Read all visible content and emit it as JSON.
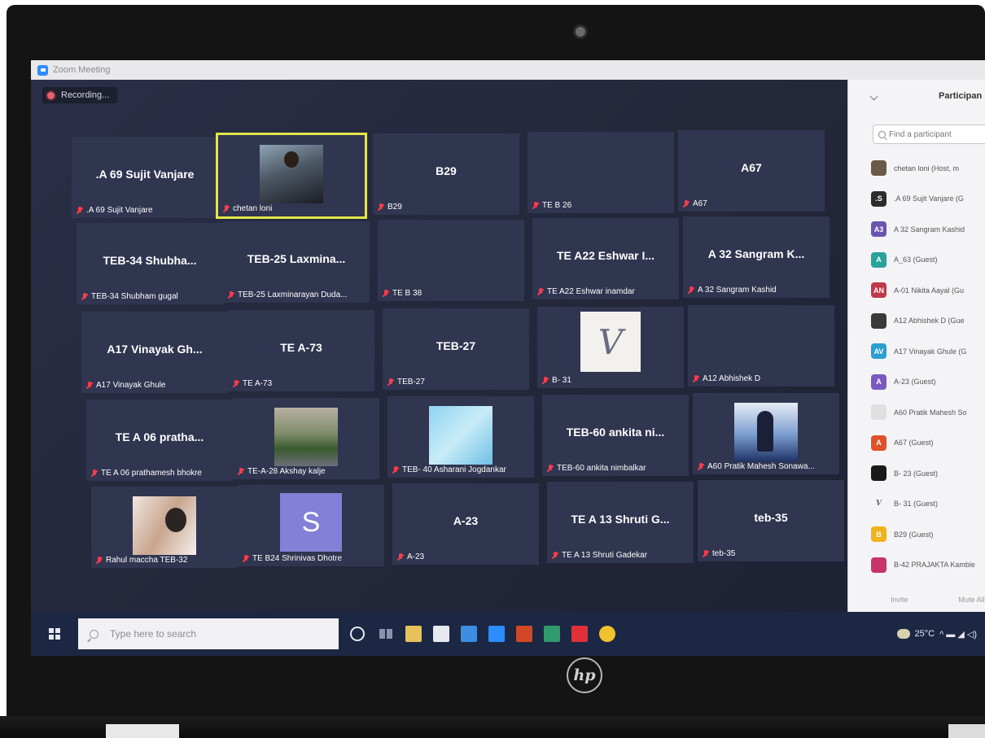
{
  "window": {
    "title": "Zoom Meeting"
  },
  "recording": {
    "label": "Recording..."
  },
  "tiles": [
    {
      "title": ".A 69 Sujit Vanjare",
      "name": ".A 69 Sujit Vanjare",
      "pic": ""
    },
    {
      "title": "",
      "name": "chetan loni",
      "pic": "person",
      "active": true
    },
    {
      "title": "B29",
      "name": "B29",
      "pic": ""
    },
    {
      "title": "",
      "name": "TE B 26",
      "pic": ""
    },
    {
      "title": "A67",
      "name": "A67",
      "pic": ""
    },
    {
      "title": "TEB-34 Shubha...",
      "name": "TEB-34 Shubham gugal",
      "pic": ""
    },
    {
      "title": "TEB-25 Laxmina...",
      "name": "TEB-25 Laxminarayan Duda...",
      "pic": ""
    },
    {
      "title": "",
      "name": "TE B 38",
      "pic": ""
    },
    {
      "title": "TE A22 Eshwar I...",
      "name": "TE A22 Eshwar inamdar",
      "pic": ""
    },
    {
      "title": "A 32 Sangram K...",
      "name": "A 32 Sangram Kashid",
      "pic": ""
    },
    {
      "title": "A17 Vinayak Gh...",
      "name": "A17 Vinayak Ghule",
      "pic": ""
    },
    {
      "title": "TE A-73",
      "name": "TE A-73",
      "pic": ""
    },
    {
      "title": "TEB-27",
      "name": "TEB-27",
      "pic": ""
    },
    {
      "title": "",
      "name": "B- 31",
      "pic": "v",
      "pic_text": "V"
    },
    {
      "title": "",
      "name": "A12 Abhishek D",
      "pic": ""
    },
    {
      "title": "TE A 06 pratha...",
      "name": "TE A 06 prathamesh bhokre",
      "pic": ""
    },
    {
      "title": "",
      "name": "TE-A-28 Akshay kalje",
      "pic": "boat"
    },
    {
      "title": "",
      "name": "TEB- 40 Asharani Jogdankar",
      "pic": "sky"
    },
    {
      "title": "TEB-60 ankita ni...",
      "name": "TEB-60 ankita nimbalkar",
      "pic": ""
    },
    {
      "title": "",
      "name": "A60 Pratik Mahesh Sonawa...",
      "pic": "shiva"
    },
    {
      "title": "",
      "name": "Rahul maccha TEB-32",
      "pic": "kids"
    },
    {
      "title": "",
      "name": "TE B24 Shrinivas Dhotre",
      "pic": "letter",
      "pic_text": "S"
    },
    {
      "title": "A-23",
      "name": "A-23",
      "pic": ""
    },
    {
      "title": "TE A 13 Shruti G...",
      "name": "TE A 13 Shruti Gadekar",
      "pic": ""
    },
    {
      "title": "teb-35",
      "name": "teb-35",
      "pic": ""
    }
  ],
  "participants": {
    "title": "Participan",
    "search_placeholder": "Find a participant",
    "list": [
      {
        "avatar": "",
        "color": "#6b5a4a",
        "name": "chetan loni (Host, m"
      },
      {
        "avatar": ".S",
        "color": "#2c2c2c",
        "name": ".A 69 Sujit Vanjare (G"
      },
      {
        "avatar": "A3",
        "color": "#6a55b0",
        "name": "A 32 Sangram Kashid"
      },
      {
        "avatar": "A",
        "color": "#27a39b",
        "name": "A_63 (Guest)"
      },
      {
        "avatar": "AN",
        "color": "#c0394b",
        "name": "A-01 Nikita Aayal (Gu"
      },
      {
        "avatar": "",
        "color": "#3a3a3a",
        "name": "A12 Abhishek D (Gue"
      },
      {
        "avatar": "AV",
        "color": "#2a9fd0",
        "name": "A17 Vinayak Ghule (G"
      },
      {
        "avatar": "A",
        "color": "#7a5ac0",
        "name": "A-23 (Guest)"
      },
      {
        "avatar": "",
        "color": "#e0e0e0",
        "name": "A60 Pratik Mahesh So"
      },
      {
        "avatar": "A",
        "color": "#e0512b",
        "name": "A67 (Guest)"
      },
      {
        "avatar": "",
        "color": "#1a1a1a",
        "name": "B- 23 (Guest)"
      },
      {
        "avatar": "V",
        "color": "#f4f4f6",
        "name": "B- 31 (Guest)"
      },
      {
        "avatar": "B",
        "color": "#f0b31b",
        "name": "B29 (Guest)"
      },
      {
        "avatar": "",
        "color": "#c8346a",
        "name": "B-42 PRAJAKTA Kamble"
      }
    ],
    "invite_label": "Invite",
    "mute_all_label": "Mute All"
  },
  "taskbar": {
    "search_placeholder": "Type here to search",
    "icons": [
      {
        "name": "file-explorer",
        "color": "#e6c25a"
      },
      {
        "name": "store",
        "color": "#e6e9f0"
      },
      {
        "name": "mail",
        "color": "#3d8de0"
      },
      {
        "name": "zoom",
        "color": "#2d8cff"
      },
      {
        "name": "powerpoint",
        "color": "#d24726"
      },
      {
        "name": "publisher",
        "color": "#2f9a6b"
      },
      {
        "name": "acrobat",
        "color": "#e0303a"
      },
      {
        "name": "chrome",
        "color": "#f2c12e"
      }
    ],
    "temperature": "25°C"
  },
  "device": {
    "brand": "hp"
  }
}
